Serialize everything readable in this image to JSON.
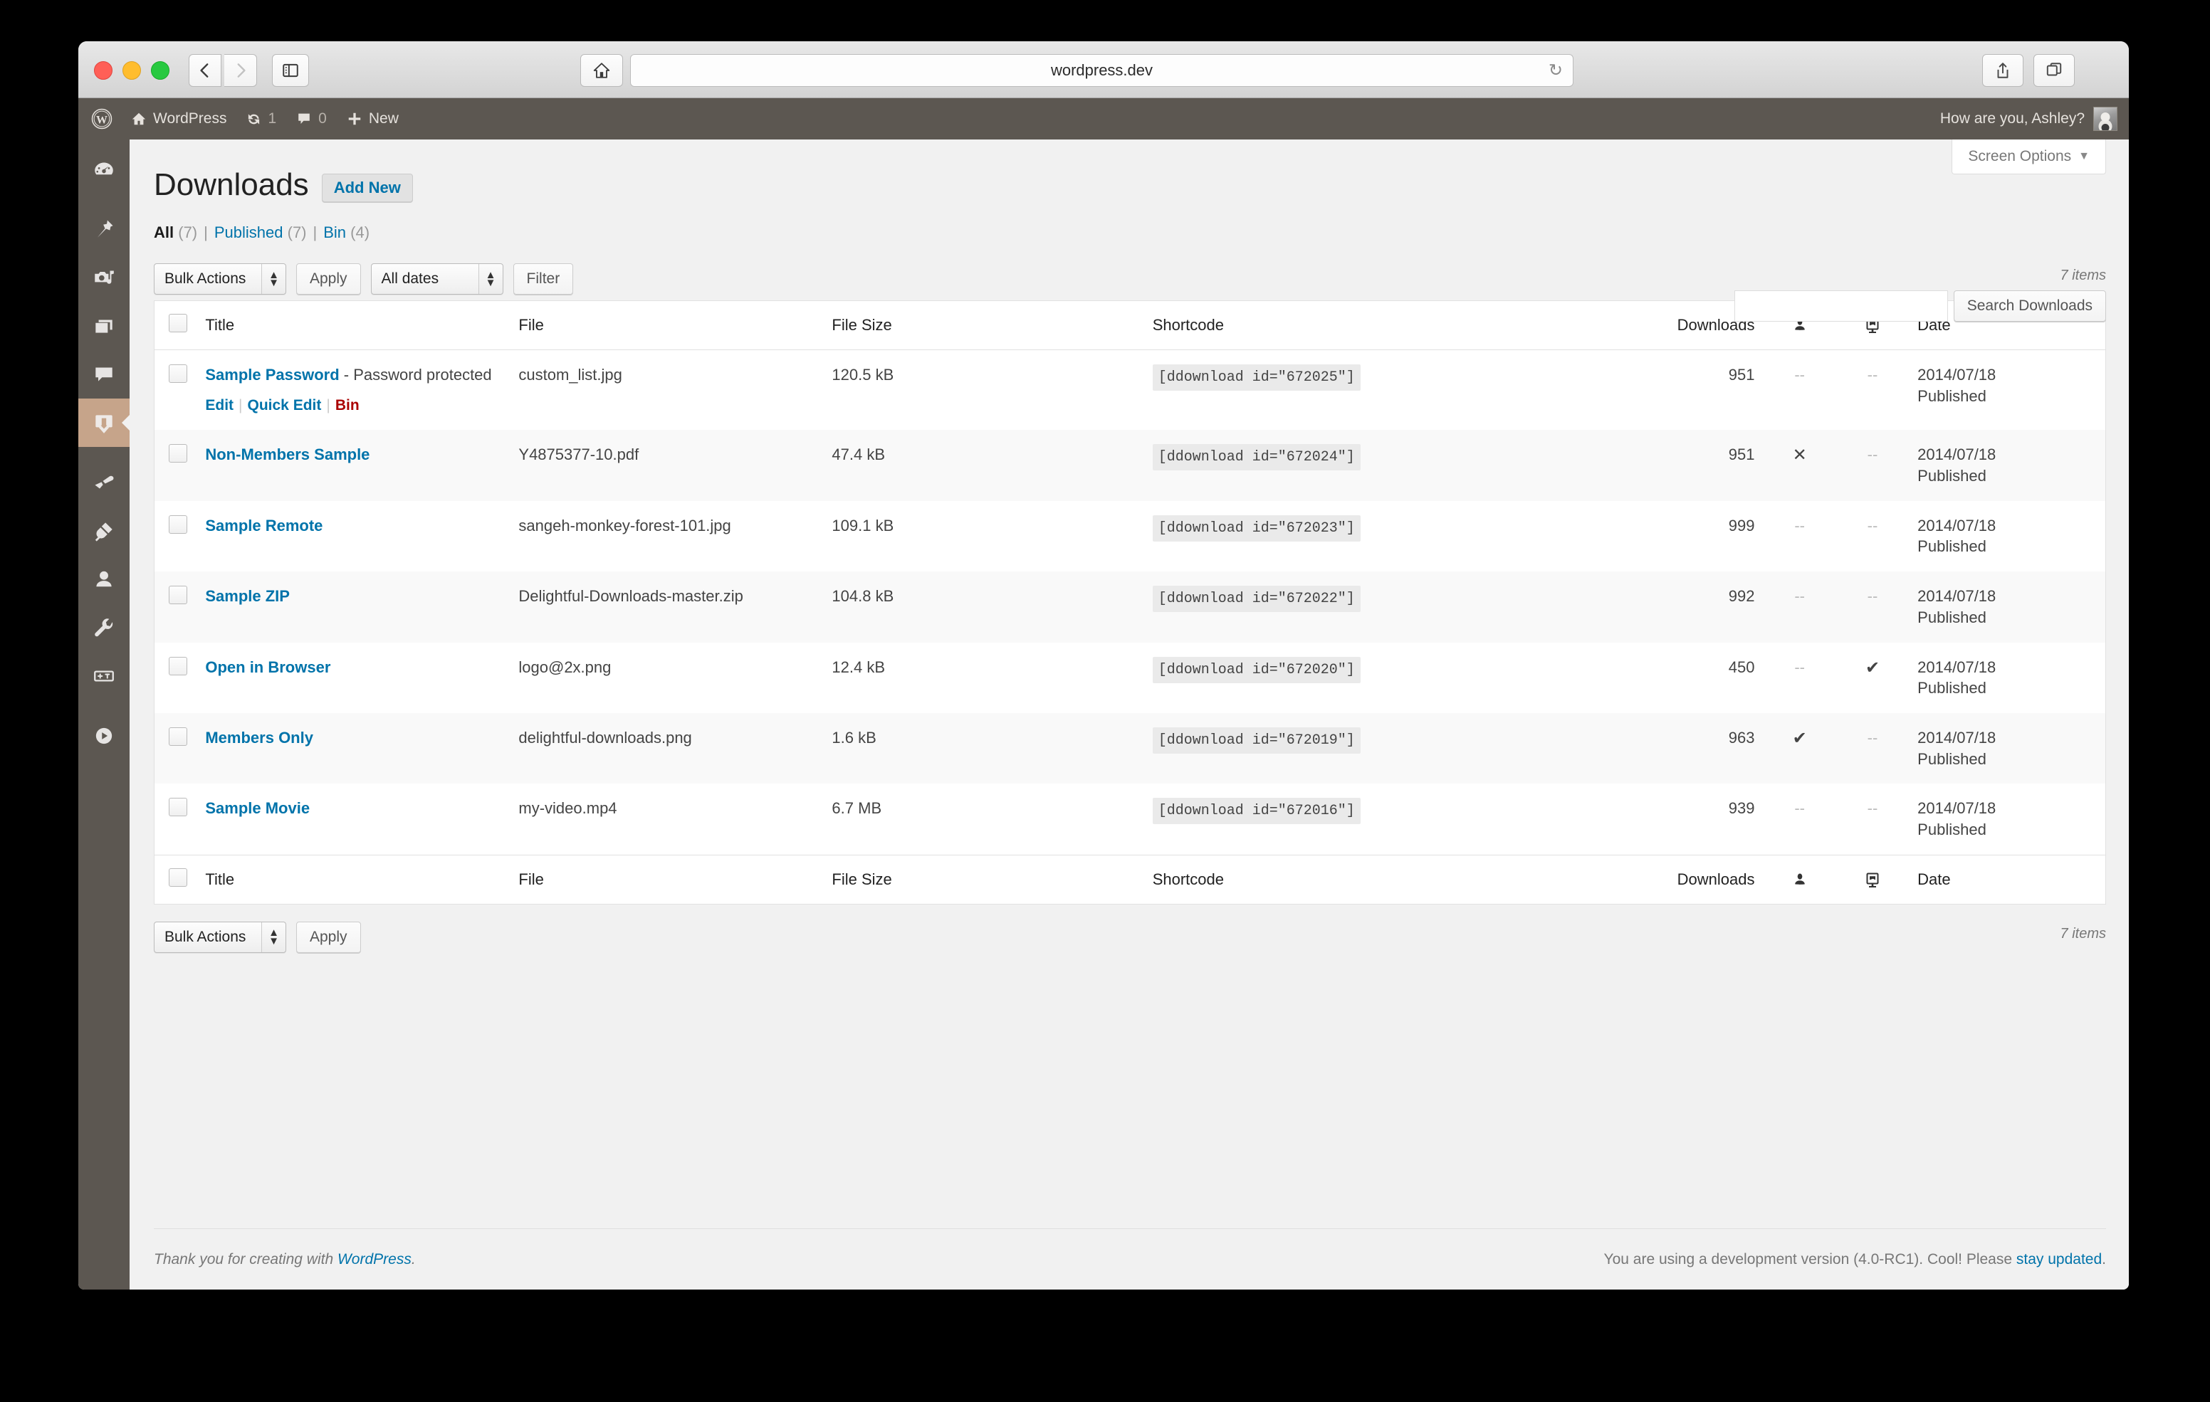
{
  "browser": {
    "url": "wordpress.dev",
    "back_icon": "chevron-left-icon",
    "forward_icon": "chevron-right-icon",
    "sidebar_icon": "sidebar-toggle-icon",
    "home_icon": "home-icon",
    "reload_icon": "reload-icon",
    "share_icon": "share-icon",
    "tabs_icon": "tabs-icon"
  },
  "adminbar": {
    "wp_logo": "wordpress-logo-icon",
    "site_name": "WordPress",
    "updates_count": "1",
    "comments_count": "0",
    "new_label": "New",
    "howdy": "How are you, Ashley?"
  },
  "sidebar": {
    "items": [
      {
        "name": "dashboard",
        "icon": "dashboard-icon",
        "current": false
      },
      {
        "name": "posts",
        "icon": "pin-icon",
        "current": false
      },
      {
        "name": "media",
        "icon": "media-icon",
        "current": false
      },
      {
        "name": "pages",
        "icon": "pages-icon",
        "current": false
      },
      {
        "name": "comments",
        "icon": "comment-icon",
        "current": false
      },
      {
        "name": "downloads",
        "icon": "download-icon",
        "current": true
      },
      {
        "name": "appearance",
        "icon": "paintbrush-icon",
        "current": false
      },
      {
        "name": "plugins",
        "icon": "plug-icon",
        "current": false
      },
      {
        "name": "users",
        "icon": "user-icon",
        "current": false
      },
      {
        "name": "tools",
        "icon": "wrench-icon",
        "current": false
      },
      {
        "name": "settings",
        "icon": "sliders-icon",
        "current": false
      },
      {
        "name": "collapse",
        "icon": "play-icon",
        "current": false
      }
    ]
  },
  "screen_options": {
    "label": "Screen Options",
    "caret": "▼"
  },
  "page": {
    "title": "Downloads",
    "add_new": "Add New"
  },
  "views": [
    {
      "label": "All",
      "count": "(7)",
      "current": true
    },
    {
      "label": "Published",
      "count": "(7)",
      "current": false
    },
    {
      "label": "Bin",
      "count": "(4)",
      "current": false
    }
  ],
  "search": {
    "value": "",
    "placeholder": "",
    "button": "Search Downloads"
  },
  "tablenav_top": {
    "bulk_actions": "Bulk Actions",
    "apply": "Apply",
    "dates": "All dates",
    "filter": "Filter",
    "displaying": "7 items"
  },
  "tablenav_bottom": {
    "bulk_actions": "Bulk Actions",
    "apply": "Apply",
    "displaying": "7 items"
  },
  "table": {
    "columns": {
      "title": "Title",
      "file": "File",
      "size": "File Size",
      "shortcode": "Shortcode",
      "downloads": "Downloads",
      "members_icon": "member-icon",
      "browser_icon": "browser-icon",
      "date": "Date"
    },
    "rows": [
      {
        "title": "Sample Password",
        "title_suffix": " - Password protected",
        "file": "custom_list.jpg",
        "size": "120.5 kB",
        "shortcode": "[ddownload id=\"672025\"]",
        "downloads": "951",
        "members": "--",
        "browser": "--",
        "date": "2014/07/18",
        "status": "Published",
        "actions": {
          "edit": "Edit",
          "quick_edit": "Quick Edit",
          "trash": "Bin"
        }
      },
      {
        "title": "Non-Members Sample",
        "title_suffix": "",
        "file": "Y4875377-10.pdf",
        "size": "47.4 kB",
        "shortcode": "[ddownload id=\"672024\"]",
        "downloads": "951",
        "members": "✕",
        "browser": "--",
        "date": "2014/07/18",
        "status": "Published",
        "actions": null
      },
      {
        "title": "Sample Remote",
        "title_suffix": "",
        "file": "sangeh-monkey-forest-101.jpg",
        "size": "109.1 kB",
        "shortcode": "[ddownload id=\"672023\"]",
        "downloads": "999",
        "members": "--",
        "browser": "--",
        "date": "2014/07/18",
        "status": "Published",
        "actions": null
      },
      {
        "title": "Sample ZIP",
        "title_suffix": "",
        "file": "Delightful-Downloads-master.zip",
        "size": "104.8 kB",
        "shortcode": "[ddownload id=\"672022\"]",
        "downloads": "992",
        "members": "--",
        "browser": "--",
        "date": "2014/07/18",
        "status": "Published",
        "actions": null
      },
      {
        "title": "Open in Browser",
        "title_suffix": "",
        "file": "logo@2x.png",
        "size": "12.4 kB",
        "shortcode": "[ddownload id=\"672020\"]",
        "downloads": "450",
        "members": "--",
        "browser": "✔",
        "date": "2014/07/18",
        "status": "Published",
        "actions": null
      },
      {
        "title": "Members Only",
        "title_suffix": "",
        "file": "delightful-downloads.png",
        "size": "1.6 kB",
        "shortcode": "[ddownload id=\"672019\"]",
        "downloads": "963",
        "members": "✔",
        "browser": "--",
        "date": "2014/07/18",
        "status": "Published",
        "actions": null
      },
      {
        "title": "Sample Movie",
        "title_suffix": "",
        "file": "my-video.mp4",
        "size": "6.7 MB",
        "shortcode": "[ddownload id=\"672016\"]",
        "downloads": "939",
        "members": "--",
        "browser": "--",
        "date": "2014/07/18",
        "status": "Published",
        "actions": null
      }
    ]
  },
  "footer": {
    "thanks_prefix": "Thank you for creating with ",
    "thanks_link": "WordPress",
    "thanks_suffix": ".",
    "version_prefix": "You are using a development version (4.0-RC1). Cool! Please ",
    "version_link": "stay updated",
    "version_suffix": "."
  },
  "colors": {
    "accent_link": "#0073aa",
    "adminbar_bg": "#5c5751",
    "current_menu_bg": "#c6a48a",
    "trash_link": "#a00000"
  }
}
